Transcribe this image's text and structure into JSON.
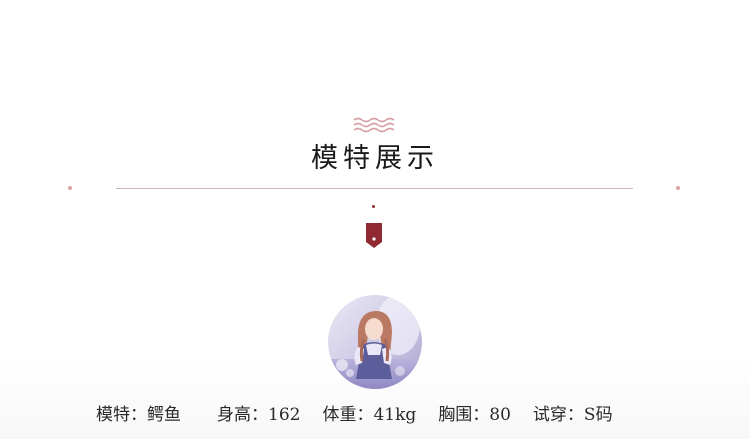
{
  "section": {
    "title": "模特展示"
  },
  "colors": {
    "accent_pink": "#d9a0a6",
    "tag_red": "#8f2a33",
    "divider": "#c9b9bd"
  },
  "icons": {
    "title_ornament": "wave-icon",
    "marker": "bookmark-tag-icon"
  },
  "model": {
    "name": "模特：鳄鱼",
    "height": "身高：162",
    "weight": "体重：41kg",
    "bust": "胸围：80",
    "size": "试穿：S码"
  }
}
